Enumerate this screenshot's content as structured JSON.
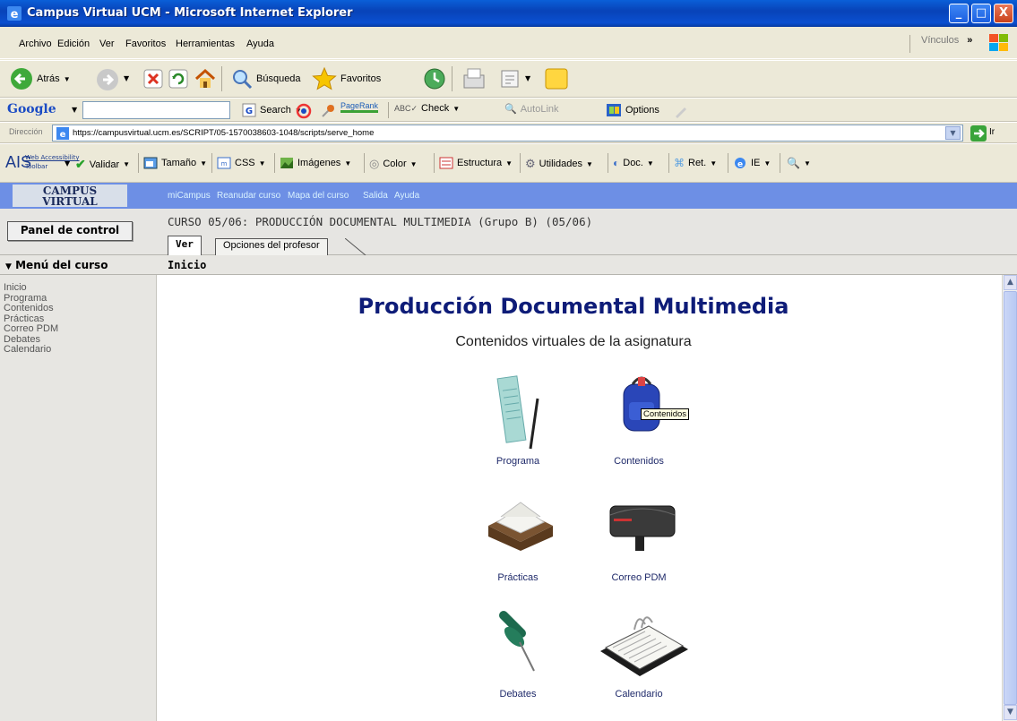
{
  "window": {
    "title": "Campus Virtual UCM - Microsoft Internet Explorer",
    "minimize": "_",
    "maximize": "□",
    "close": "X"
  },
  "menubar": {
    "items": [
      "Archivo",
      "Edición",
      "Ver",
      "Favoritos",
      "Herramientas",
      "Ayuda"
    ],
    "links_label": "Vínculos",
    "chevron": "»"
  },
  "standard_toolbar": {
    "back": "Atrás",
    "search": "Búsqueda",
    "favorites": "Favoritos"
  },
  "google_toolbar": {
    "logo": "Google",
    "search": "Search",
    "pagerank": "PageRank",
    "check": "Check",
    "autolink": "AutoLink",
    "options": "Options"
  },
  "address_bar": {
    "label": "Dirección",
    "url": "https://campusvirtual.ucm.es/SCRIPT/05-1570038603-1048/scripts/serve_home",
    "go": "Ir"
  },
  "ais_toolbar": {
    "logo": "AIS",
    "logo_sub1": "Web Accessibility",
    "logo_sub2": "Toolbar",
    "items": [
      "Validar",
      "Tamaño",
      "CSS",
      "Imágenes",
      "Color",
      "Estructura",
      "Utilidades",
      "Doc.",
      "Ret.",
      "IE"
    ]
  },
  "campus": {
    "logo_line1": "CAMPUS",
    "logo_line2": "VIRTUAL",
    "nav": [
      "miCampus",
      "Reanudar curso",
      "Mapa del curso",
      "Salida",
      "Ayuda"
    ]
  },
  "course": {
    "panel_button": "Panel de control",
    "title": "CURSO 05/06: PRODUCCIÓN DOCUMENTAL MULTIMEDIA (Grupo B) (05/06)",
    "tabs": [
      "Ver",
      "Opciones del profesor"
    ]
  },
  "sidebar": {
    "header": "Menú del curso",
    "links": [
      "Inicio",
      "Programa",
      "Contenidos",
      "Prácticas",
      "Correo PDM",
      "Debates",
      "Calendario"
    ]
  },
  "breadcrumb": "Inicio",
  "main": {
    "heading": "Producción Documental Multimedia",
    "subtitle": "Contenidos virtuales de la asignatura",
    "tiles": [
      "Programa",
      "Contenidos",
      "Prácticas",
      "Correo PDM",
      "Debates",
      "Calendario"
    ],
    "tooltip": "Contenidos"
  }
}
